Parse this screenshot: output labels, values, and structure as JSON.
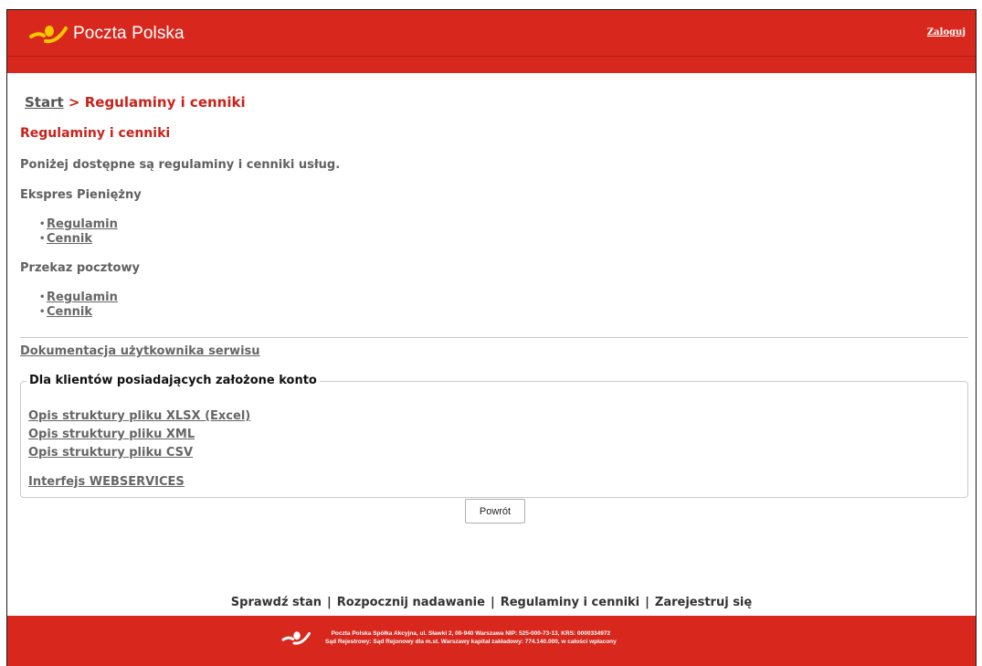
{
  "header": {
    "brand": "Poczta Polska",
    "login_label": "Zaloguj"
  },
  "breadcrumb": {
    "home": "Start",
    "separator": ">",
    "current": "Regulaminy i cenniki"
  },
  "page_title": "Regulaminy i cenniki",
  "intro": "Poniżej dostępne są regulaminy i cenniki usług.",
  "sections": [
    {
      "title": "Ekspres Pieniężny",
      "links": [
        "Regulamin",
        "Cennik"
      ]
    },
    {
      "title": "Przekaz pocztowy",
      "links": [
        "Regulamin",
        "Cennik"
      ]
    }
  ],
  "docs_link": "Dokumentacja użytkownika serwisu",
  "account_box": {
    "legend": "Dla klientów posiadających założone konto",
    "links": [
      "Opis struktury pliku XLSX (Excel)",
      "Opis struktury pliku XML",
      "Opis struktury pliku CSV"
    ],
    "webservices": "Interfejs WEBSERVICES"
  },
  "back_button": "Powrót",
  "bottom_nav": [
    "Sprawdź stan",
    "Rozpocznij nadawanie",
    "Regulaminy i cenniki",
    "Zarejestruj się"
  ],
  "bottom_nav_separator": "|",
  "footer": {
    "line1": "Poczta Polska Spółka Akcyjna, ul. Sławki 2, 00-940 Warszawa NIP: 525-000-73-13, KRS: 0000334972",
    "line2": "Sąd Rejestrowy: Sąd Rejonowy dla m.st. Warszawy kapitał zakładowy: 774.140.000, w całości wpłacony"
  },
  "colors": {
    "brand_red": "#d8281e",
    "title_red": "#c9221b",
    "logo_yellow": "#f5c800"
  }
}
